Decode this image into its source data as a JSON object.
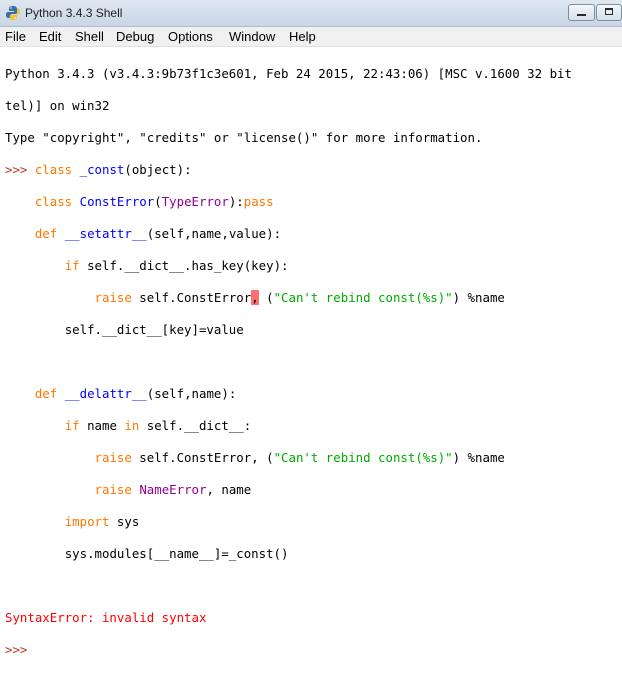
{
  "window": {
    "title": "Python 3.4.3 Shell",
    "icon": "python-logo-icon"
  },
  "menu": {
    "items": [
      "File",
      "Edit",
      "Shell",
      "Debug",
      "Options",
      "Window",
      "Help"
    ]
  },
  "shell": {
    "banner": [
      "Python 3.4.3 (v3.4.3:9b73f1c3e601, Feb 24 2015, 22:43:06) [MSC v.1600 32 bit",
      "tel)] on win32",
      "Type \"copyright\", \"credits\" or \"license()\" for more information."
    ],
    "prompt": ">>> ",
    "indent4": "    ",
    "indent8": "        ",
    "indent12": "            ",
    "tokens": {
      "class": "class",
      "const": "_const",
      "object_paren": "(object):",
      "const_error": "ConstError",
      "open_paren": "(",
      "type_error": "TypeError",
      "close_colon": "):",
      "pass": "pass",
      "def": "def",
      "setattr": "__setattr__",
      "setattr_args": "(self,name,value):",
      "if": "if",
      "setattr_cond": " self.__dict__.has_key(key):",
      "raise": "raise",
      "self_const_error": " self.ConstError",
      "comma": ",",
      "space_paren": " (",
      "msg_string": "\"Can't rebind const(%s)\"",
      "mod_name": ") %name",
      "dict_assign": "self.__dict__[key]=value",
      "delattr": "__delattr__",
      "delattr_args": "(self,name):",
      "name": " name ",
      "in": "in",
      "self_dict_colon": " self.__dict__:",
      "self_const_error_comma": " self.ConstError, (",
      "name_error": "NameError",
      "comma_name": ", name",
      "import": "import",
      "sys": " sys",
      "modules_assign": "sys.modules[__name__]=_const()",
      "space": " "
    },
    "error": "SyntaxError: invalid syntax",
    "final_prompt": ">>>"
  }
}
